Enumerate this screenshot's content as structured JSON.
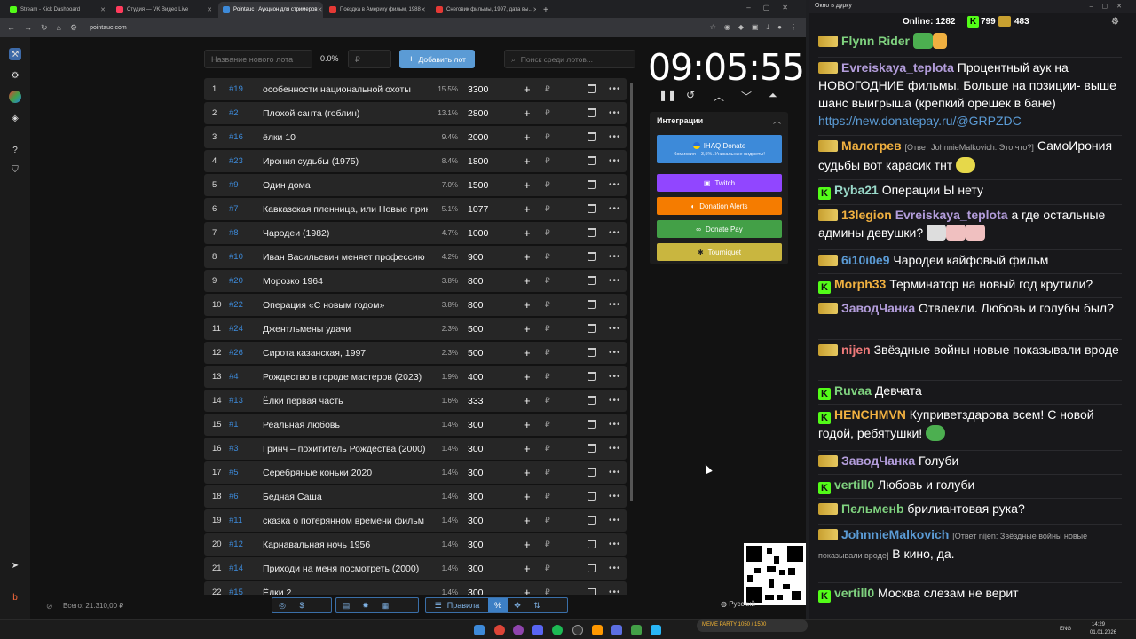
{
  "browser": {
    "tabs": [
      {
        "label": "Stream - Kick Dashboard",
        "color": "#53fc18"
      },
      {
        "label": "Студия — VK Видео Live",
        "color": "#ff3b5c"
      },
      {
        "label": "Pointauc | Аукцион для стримеров",
        "color": "#3d8ad9"
      },
      {
        "label": "Поездка в Америку фильм, 1988",
        "color": "#e53935"
      },
      {
        "label": "Снеговик фильмы, 1997, дата вы...",
        "color": "#e53935"
      }
    ],
    "url": "pointauc.com"
  },
  "toolbar": {
    "new_lot_placeholder": "Название нового лота",
    "percent": "0.0%",
    "price_placeholder": "₽",
    "add_label": "Добавить лот",
    "search_placeholder": "Поиск среди лотов..."
  },
  "lots": [
    {
      "n": "1",
      "id": "#19",
      "title": "особенности национальной охоты",
      "pct": "15.5%",
      "amount": "3300"
    },
    {
      "n": "2",
      "id": "#2",
      "title": "Плохой санта (гоблин)",
      "pct": "13.1%",
      "amount": "2800"
    },
    {
      "n": "3",
      "id": "#16",
      "title": "ёлки 10",
      "pct": "9.4%",
      "amount": "2000"
    },
    {
      "n": "4",
      "id": "#23",
      "title": "Ирония судьбы (1975)",
      "pct": "8.4%",
      "amount": "1800"
    },
    {
      "n": "5",
      "id": "#9",
      "title": "Один дома",
      "pct": "7.0%",
      "amount": "1500"
    },
    {
      "n": "6",
      "id": "#7",
      "title": "Кавказская пленница, или Новые приключения Шурика",
      "pct": "5.1%",
      "amount": "1077"
    },
    {
      "n": "7",
      "id": "#8",
      "title": "Чародеи (1982)",
      "pct": "4.7%",
      "amount": "1000"
    },
    {
      "n": "8",
      "id": "#10",
      "title": "Иван Васильевич меняет профессию",
      "pct": "4.2%",
      "amount": "900"
    },
    {
      "n": "9",
      "id": "#20",
      "title": "Морозко 1964",
      "pct": "3.8%",
      "amount": "800"
    },
    {
      "n": "10",
      "id": "#22",
      "title": "Операция «С новым годом»",
      "pct": "3.8%",
      "amount": "800"
    },
    {
      "n": "11",
      "id": "#24",
      "title": "Джентльмены удачи",
      "pct": "2.3%",
      "amount": "500"
    },
    {
      "n": "12",
      "id": "#26",
      "title": "Сирота казанская, 1997",
      "pct": "2.3%",
      "amount": "500"
    },
    {
      "n": "13",
      "id": "#4",
      "title": "Рождество в городе мастеров (2023)",
      "pct": "1.9%",
      "amount": "400"
    },
    {
      "n": "14",
      "id": "#13",
      "title": "Ёлки первая часть",
      "pct": "1.6%",
      "amount": "333"
    },
    {
      "n": "15",
      "id": "#1",
      "title": "Реальная любовь",
      "pct": "1.4%",
      "amount": "300"
    },
    {
      "n": "16",
      "id": "#3",
      "title": "Гринч – похититель Рождества (2000)",
      "pct": "1.4%",
      "amount": "300"
    },
    {
      "n": "17",
      "id": "#5",
      "title": "Серебряные коньки 2020",
      "pct": "1.4%",
      "amount": "300"
    },
    {
      "n": "18",
      "id": "#6",
      "title": "Бедная Саша",
      "pct": "1.4%",
      "amount": "300"
    },
    {
      "n": "19",
      "id": "#11",
      "title": "сказка о потерянном времени фильм",
      "pct": "1.4%",
      "amount": "300"
    },
    {
      "n": "20",
      "id": "#12",
      "title": "Карнавальная ночь 1956",
      "pct": "1.4%",
      "amount": "300"
    },
    {
      "n": "21",
      "id": "#14",
      "title": "Приходи на меня посмотреть (2000)",
      "pct": "1.4%",
      "amount": "300"
    },
    {
      "n": "22",
      "id": "#15",
      "title": "Ёлки 2",
      "pct": "1.4%",
      "amount": "300"
    }
  ],
  "timer": "09:05:55",
  "integrations": {
    "title": "Интеграции",
    "ihaq": "IHAQ Donate",
    "ihaq_sub": "Комиссия – 3,5%. Уникальные виджеты!",
    "twitch": "Twitch",
    "donation_alerts": "Donation Alerts",
    "donate_pay": "Donate Pay",
    "tourniquet": "Tourniquet"
  },
  "footer": {
    "total": "Всего: 21.310,00 ₽",
    "rules": "Правила",
    "lang": "Русский"
  },
  "chat": {
    "window_title": "Окно в дурку",
    "online": "Online: 1282",
    "stat1": "799",
    "stat2": "483",
    "messages": [
      {
        "user": "Flynn Rider",
        "color": "#7fd27f",
        "text": ""
      },
      {
        "user": "Evreiskaya_teplota",
        "color": "#b39ddb",
        "text": "Процентный аук на НОВОГОДНИЕ фильмы. Больше на позиции- выше шанс выигрыша (крепкий орешек в бане)",
        "link": "https://new.donatepay.ru/@GRPZDC"
      },
      {
        "user": "Малогрев",
        "color": "#f0b040",
        "reply": "[Ответ JohnnieMalkovich: Это что?]",
        "text": "СамоИрония судьбы вот карасик тнт"
      },
      {
        "user": "Ryba21",
        "color": "#9ad9c9",
        "text": "Операции Ы нету"
      },
      {
        "user": "13legion",
        "color": "#f0b040",
        "mention": "Evreiskaya_teplota",
        "text": "а где остальные админы девушки?"
      },
      {
        "user": "6i10i0e9",
        "color": "#5b9bd5",
        "text": "Чародеи кайфовый фильм"
      },
      {
        "user": "Morph33",
        "color": "#f0b040",
        "text": "Терминатор на новый год крутили?"
      },
      {
        "user": "ЗаводЧанка",
        "color": "#b39ddb",
        "text": "Отвлекли. Любовь и голубы был?"
      },
      {
        "user": "nijen",
        "color": "#ef7a7a",
        "text": "Звёздные войны новые показывали вроде"
      },
      {
        "user": "Ruvaa",
        "color": "#7fd27f",
        "text": "Девчата"
      },
      {
        "user": "HENCHMVN",
        "color": "#f0b040",
        "text": "Куприветздарова всем! С новой годой, ребятушки!"
      },
      {
        "user": "ЗаводЧанка",
        "color": "#b39ddb",
        "text": "Голуби"
      },
      {
        "user": "vertill0",
        "color": "#7fd27f",
        "text": "Любовь и голуби"
      },
      {
        "user": "Пельменb",
        "color": "#7fd27f",
        "text": "брилиантовая рука?"
      },
      {
        "user": "JohnnieMalkovich",
        "color": "#5b9bd5",
        "reply": "[Ответ nijen: Звёздные войны новые показывали вроде]",
        "text": "В кино, да."
      },
      {
        "user": "vertill0",
        "color": "#7fd27f",
        "text": "Москва слезам не верит"
      }
    ]
  },
  "taskbar": {
    "lang": "ENG",
    "time": "14:29",
    "date": "01.01.2026",
    "meme": "MEME PARTY 1050 / 1500"
  }
}
